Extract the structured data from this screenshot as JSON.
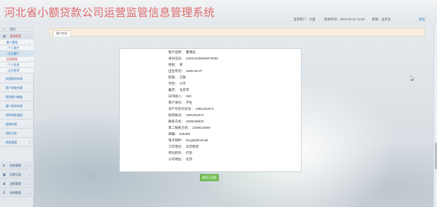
{
  "site_title": "河北省小额贷款公司运营监管信息管理系统",
  "topbar": {
    "user": "当前用户：大圣",
    "login_time": "登录时间：2019-02-12 13:30",
    "role": "权限：业务员",
    "logout": "退出"
  },
  "sidebar": {
    "home": "首页",
    "groups": [
      {
        "label": "基础管理",
        "items": [
          "客户管理",
          "个人客户",
          "企业客户"
        ]
      },
      {
        "label": "担保管理",
        "items": [
          "个人担保",
          "企业担保"
        ]
      }
    ],
    "links": [
      "快速放贷申请",
      "客户调查申请",
      "更改客户额度",
      "客户放贷申请",
      "贷款审批通道",
      "展期申请",
      "调阶分类",
      "审批管理"
    ],
    "bottom_groups": [
      "财务管理",
      "还款记录",
      "流程管理",
      "系统管理"
    ]
  },
  "tabs": {
    "active": "客户信息"
  },
  "detail": {
    "fields": [
      {
        "key": "客户名称：",
        "value": "霍瑞珏"
      },
      {
        "key": "身份证号：",
        "value": "449413199606079460"
      },
      {
        "key": "性别：",
        "value": "男"
      },
      {
        "key": "出生年月：",
        "value": "1995-06-07"
      },
      {
        "key": "民族：",
        "value": "汉族"
      },
      {
        "key": "学历：",
        "value": "小学"
      },
      {
        "key": "籍贯：",
        "value": "北京市"
      },
      {
        "key": "日均收入：",
        "value": "250"
      },
      {
        "key": "客户身份：",
        "value": "学生"
      },
      {
        "key": "日户付支付日号：",
        "value": "1981261874"
      },
      {
        "key": "收息账号：",
        "value": "1981261874"
      },
      {
        "key": "联系方式：",
        "value": "4008238825"
      },
      {
        "key": "第二联系方式：",
        "value": "1256012580"
      },
      {
        "key": "邮编：",
        "value": "525496"
      },
      {
        "key": "电子邮件：",
        "value": "shcg8@foxmail"
      },
      {
        "key": "工作单位：",
        "value": "北京新武"
      },
      {
        "key": "单位职务：",
        "value": "打杂"
      },
      {
        "key": "公司地址：",
        "value": "北京"
      }
    ]
  },
  "back_button": "返回上页面",
  "colors": {
    "title": "#e06a6a",
    "accent_button": "#79c25a",
    "nav_active_group": "#c24a4a",
    "link": "#2a6fb2"
  }
}
